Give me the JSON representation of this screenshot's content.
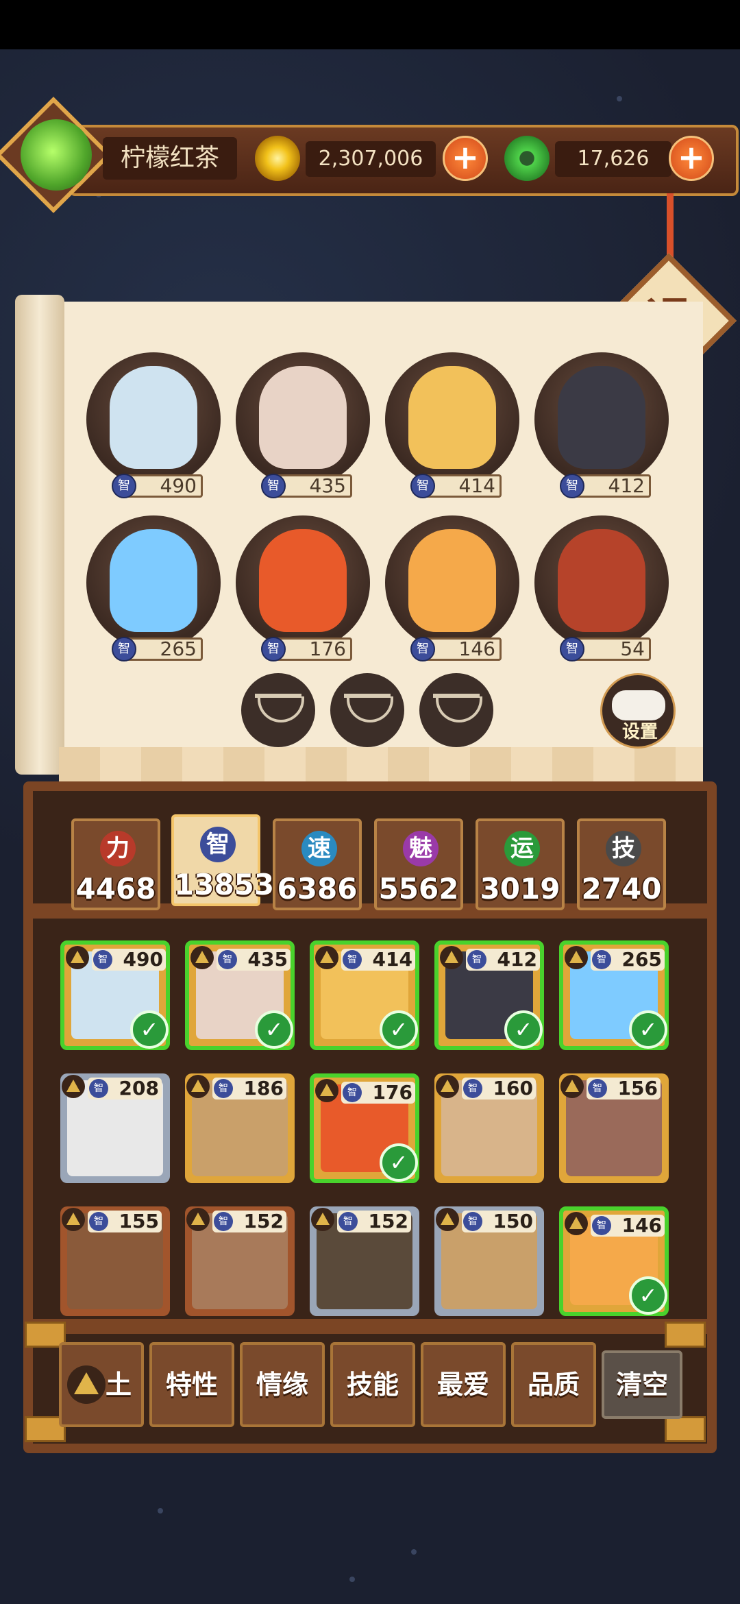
{
  "player": {
    "name": "柠檬红茶"
  },
  "currency": {
    "gold": "2,307,006",
    "jade": "17,626"
  },
  "exit_label": "退",
  "settings_label": "设置",
  "stat_label": "智",
  "team": [
    {
      "value": "490",
      "art": "#cfe3f0"
    },
    {
      "value": "435",
      "art": "#e8d3c6"
    },
    {
      "value": "414",
      "art": "#f2c15a"
    },
    {
      "value": "412",
      "art": "#3b3a45"
    },
    {
      "value": "265",
      "art": "#7ecbff"
    },
    {
      "value": "176",
      "art": "#e85a2a"
    },
    {
      "value": "146",
      "art": "#f5a94a"
    },
    {
      "value": "54",
      "art": "#b6432a"
    }
  ],
  "stats": [
    {
      "label": "力",
      "value": "4468",
      "color": "#b83a2a"
    },
    {
      "label": "智",
      "value": "13853",
      "color": "#3c4d9a"
    },
    {
      "label": "速",
      "value": "6386",
      "color": "#2a8ac0"
    },
    {
      "label": "魅",
      "value": "5562",
      "color": "#9a3aa8"
    },
    {
      "label": "运",
      "value": "3019",
      "color": "#2a9a3a"
    },
    {
      "label": "技",
      "value": "2740",
      "color": "#4a4a4a"
    }
  ],
  "roster": [
    {
      "value": "490",
      "selected": true,
      "frame": "gold",
      "art": "#cfe3f0"
    },
    {
      "value": "435",
      "selected": true,
      "frame": "gold",
      "art": "#e8d3c6"
    },
    {
      "value": "414",
      "selected": true,
      "frame": "gold",
      "art": "#f2c15a"
    },
    {
      "value": "412",
      "selected": true,
      "frame": "gold",
      "art": "#3b3a45"
    },
    {
      "value": "265",
      "selected": true,
      "frame": "gold",
      "art": "#7ecbff"
    },
    {
      "value": "208",
      "selected": false,
      "frame": "silver",
      "art": "#e8e8e8"
    },
    {
      "value": "186",
      "selected": false,
      "frame": "gold",
      "art": "#c9a06a"
    },
    {
      "value": "176",
      "selected": true,
      "frame": "gold",
      "art": "#e85a2a"
    },
    {
      "value": "160",
      "selected": false,
      "frame": "gold",
      "art": "#d8b48a"
    },
    {
      "value": "156",
      "selected": false,
      "frame": "gold",
      "art": "#9a6a5a"
    },
    {
      "value": "155",
      "selected": false,
      "frame": "bronze",
      "art": "#8a5a3a"
    },
    {
      "value": "152",
      "selected": false,
      "frame": "bronze",
      "art": "#a87a5a"
    },
    {
      "value": "152",
      "selected": false,
      "frame": "silver",
      "art": "#5a4a3a"
    },
    {
      "value": "150",
      "selected": false,
      "frame": "silver",
      "art": "#c9a06a"
    },
    {
      "value": "146",
      "selected": true,
      "frame": "gold",
      "art": "#f5a94a"
    }
  ],
  "filters": [
    "土",
    "特性",
    "情缘",
    "技能",
    "最爱",
    "品质",
    "清空"
  ]
}
